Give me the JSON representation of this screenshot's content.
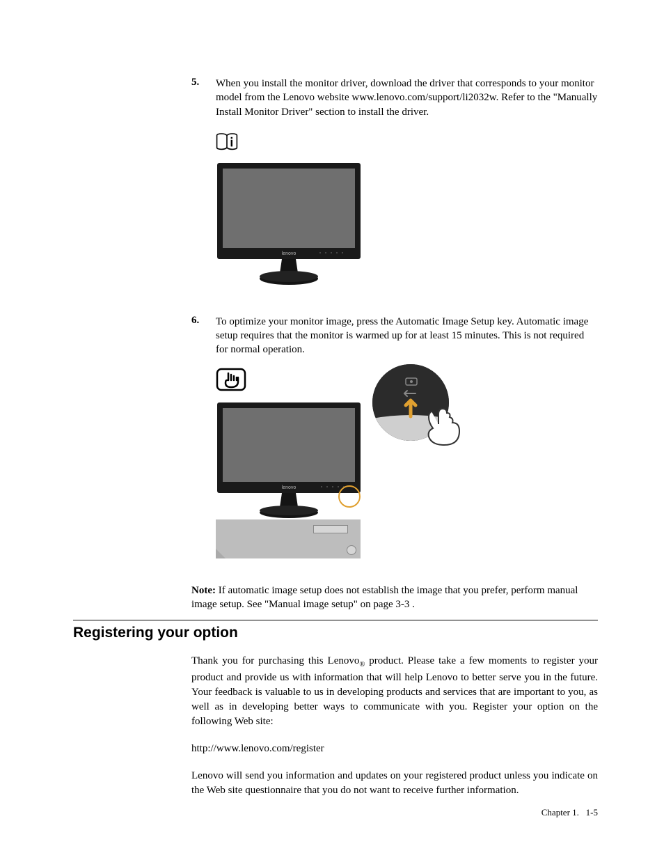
{
  "steps": {
    "five": {
      "num": "5.",
      "text": "When you install the monitor driver, download the driver that corresponds to your monitor model from the Lenovo website www.lenovo.com/support/li2032w. Refer to the \"Manually Install Monitor Driver\" section to install the driver."
    },
    "six": {
      "num": "6.",
      "text": "To optimize your monitor image, press the Automatic Image Setup key. Automatic image setup requires that the monitor is warmed up for at least 15 minutes. This is not required for normal operation."
    }
  },
  "note": {
    "label": "Note:",
    "text": " If automatic image setup does not establish the image that you prefer, perform manual image setup. See \"Manual image setup\" on page 3-3 ."
  },
  "section": {
    "heading": "Registering your option",
    "para1_a": "Thank you for purchasing this Lenovo",
    "para1_sub": "®",
    "para1_b": " product. Please take a few moments to register your product and provide us with information that will help Lenovo to better serve you in the future. Your feedback is valuable to us in developing products and services that are important to you, as well as in developing better ways to communicate with you. Register your option on the following Web site:",
    "url": "http://www.lenovo.com/register",
    "para2": "Lenovo will send you information and updates on your registered product unless you indicate on the Web site questionnaire that you do not want to receive further information."
  },
  "footer": {
    "chapter": "Chapter 1.",
    "page": "1-5"
  },
  "icons": {
    "info_book": "info-book-icon",
    "hand_press": "hand-press-icon",
    "monitor": "monitor-image",
    "zoom": "zoom-detail",
    "finger": "finger-pointer"
  }
}
